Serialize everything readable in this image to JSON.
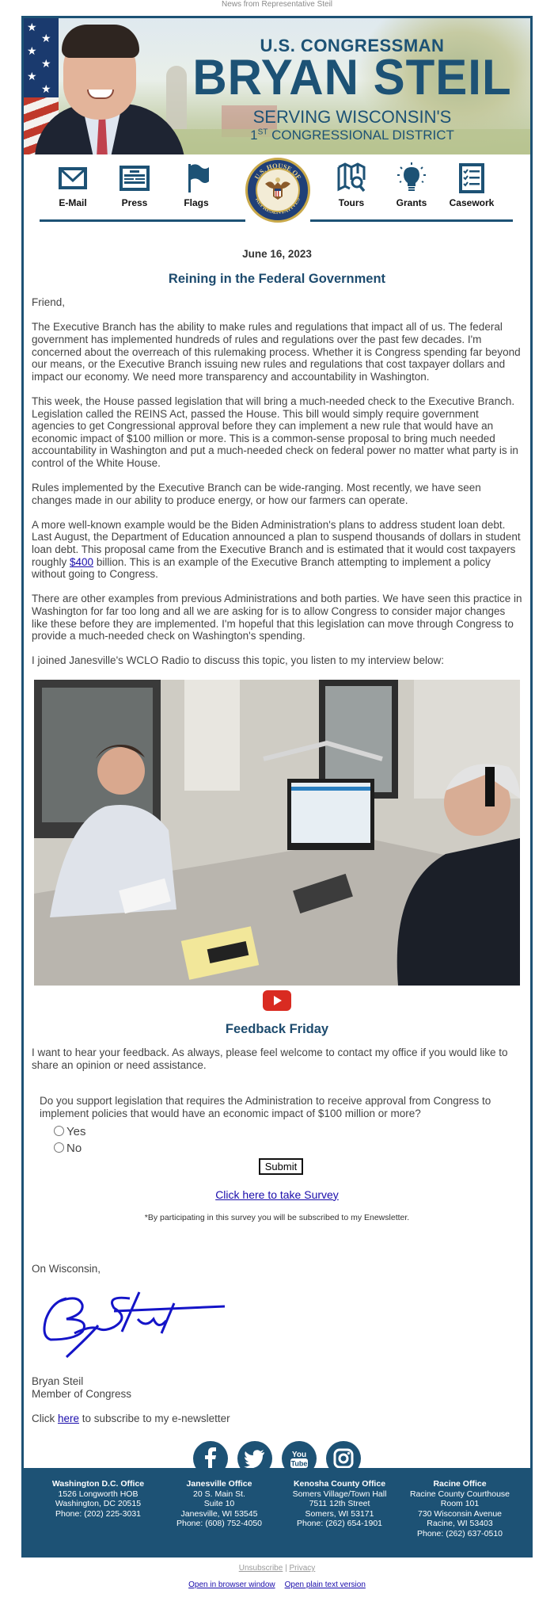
{
  "preheader": "News from Representative Steil",
  "banner": {
    "line1": "U.S. CONGRESSMAN",
    "line2": "BRYAN STEIL",
    "line3": "SERVING WISCONSIN'S",
    "line4_num": "1",
    "line4_sup": "ST",
    "line4_rest": " CONGRESSIONAL DISTRICT"
  },
  "nav": {
    "items": [
      {
        "label": "E-Mail",
        "icon": "envelope-icon"
      },
      {
        "label": "Press",
        "icon": "newspaper-icon"
      },
      {
        "label": "Flags",
        "icon": "flag-icon"
      },
      {
        "label": "Tours",
        "icon": "map-search-icon"
      },
      {
        "label": "Grants",
        "icon": "lightbulb-icon"
      },
      {
        "label": "Casework",
        "icon": "checklist-icon"
      }
    ],
    "seal_text_top": "U.S. HOUSE OF",
    "seal_text_bottom": "REPRESENTATIVES"
  },
  "article": {
    "date": "June 16, 2023",
    "title": "Reining in the Federal Government",
    "salutation": "Friend,",
    "p1": "The Executive Branch has the ability to make rules and regulations that impact all of us. The federal government has implemented hundreds of rules and regulations over the past few decades. I'm concerned about the overreach of this rulemaking process. Whether it is Congress spending far beyond our means, or the Executive Branch issuing new rules and regulations that cost taxpayer dollars and impact our economy. We need more transparency and accountability in Washington.",
    "p2": "This week, the House passed legislation that will bring a much-needed check to the Executive Branch. Legislation called the REINS Act, passed the House. This bill would simply require government agencies to get Congressional approval before they can implement a new rule that would have an economic impact of $100 million or more. This is a common-sense proposal to bring much needed accountability in Washington and put a much-needed check on federal power no matter what party is in control of the White House.",
    "p3": "Rules implemented by the Executive Branch can be wide-ranging. Most recently, we have seen changes made in our ability to produce energy, or how our farmers can operate.",
    "p4_before": "A more well-known example would be the Biden Administration's plans to address student loan debt. Last August, the Department of Education announced a plan to suspend thousands of dollars in student loan debt. This proposal came from the Executive Branch and is estimated that it would cost taxpayers roughly ",
    "p4_link": "$400",
    "p4_after": " billion. This is an example of the Executive Branch attempting to implement a policy without going to Congress.",
    "p5": "There are other examples from previous Administrations and both parties. We have seen this practice in Washington for far too long and all we are asking for is to allow Congress to consider major changes like these before they are implemented. I'm hopeful that this legislation can move through Congress to provide a much-needed check on Washington's spending.",
    "p6": "I joined Janesville's WCLO Radio to discuss this topic, you listen to my interview below:"
  },
  "feedback": {
    "title": "Feedback Friday",
    "intro": "I want to hear your feedback. As always, please feel welcome to contact my office if you would like to share an opinion or need assistance.",
    "question": "Do you support legislation that requires the Administration to receive approval from Congress to implement policies that would have an economic impact of $100 million or more?",
    "options": [
      "Yes",
      "No"
    ],
    "submit_label": "Submit",
    "survey_link": "Click here to take Survey",
    "note": "*By participating in this survey you will be subscribed to my Enewsletter."
  },
  "closing": {
    "signoff": "On Wisconsin,",
    "name": "Bryan Steil",
    "role": "Member of Congress",
    "subscribe_before": "Click ",
    "subscribe_link": "here",
    "subscribe_after": " to subscribe to my e-newsletter"
  },
  "social": [
    "facebook-icon",
    "twitter-icon",
    "youtube-icon",
    "instagram-icon"
  ],
  "offices": [
    {
      "name": "Washington D.C. Office",
      "lines": [
        "1526 Longworth HOB",
        "Washington, DC 20515",
        "Phone: (202) 225-3031"
      ]
    },
    {
      "name": "Janesville Office",
      "lines": [
        "20 S. Main St.",
        "Suite 10",
        "Janesville, WI 53545",
        "Phone: (608) 752-4050"
      ]
    },
    {
      "name": "Kenosha County Office",
      "lines": [
        "Somers Village/Town Hall",
        "7511 12th Street",
        "Somers, WI 53171",
        "Phone: (262) 654-1901"
      ]
    },
    {
      "name": "Racine Office",
      "lines": [
        "Racine County Courthouse",
        "Room 101",
        "730 Wisconsin Avenue",
        "Racine, WI 53403",
        "Phone: (262) 637-0510"
      ]
    }
  ],
  "bottom": {
    "unsubscribe": "Unsubscribe",
    "separator": "|",
    "privacy": "Privacy",
    "browser": "Open in browser window",
    "plaintext": "Open plain text version"
  },
  "colors": {
    "brand_blue": "#1d5275",
    "heading_blue": "#1d4b6e",
    "youtube_red": "#d92b21",
    "signature_blue": "#1414c8"
  }
}
